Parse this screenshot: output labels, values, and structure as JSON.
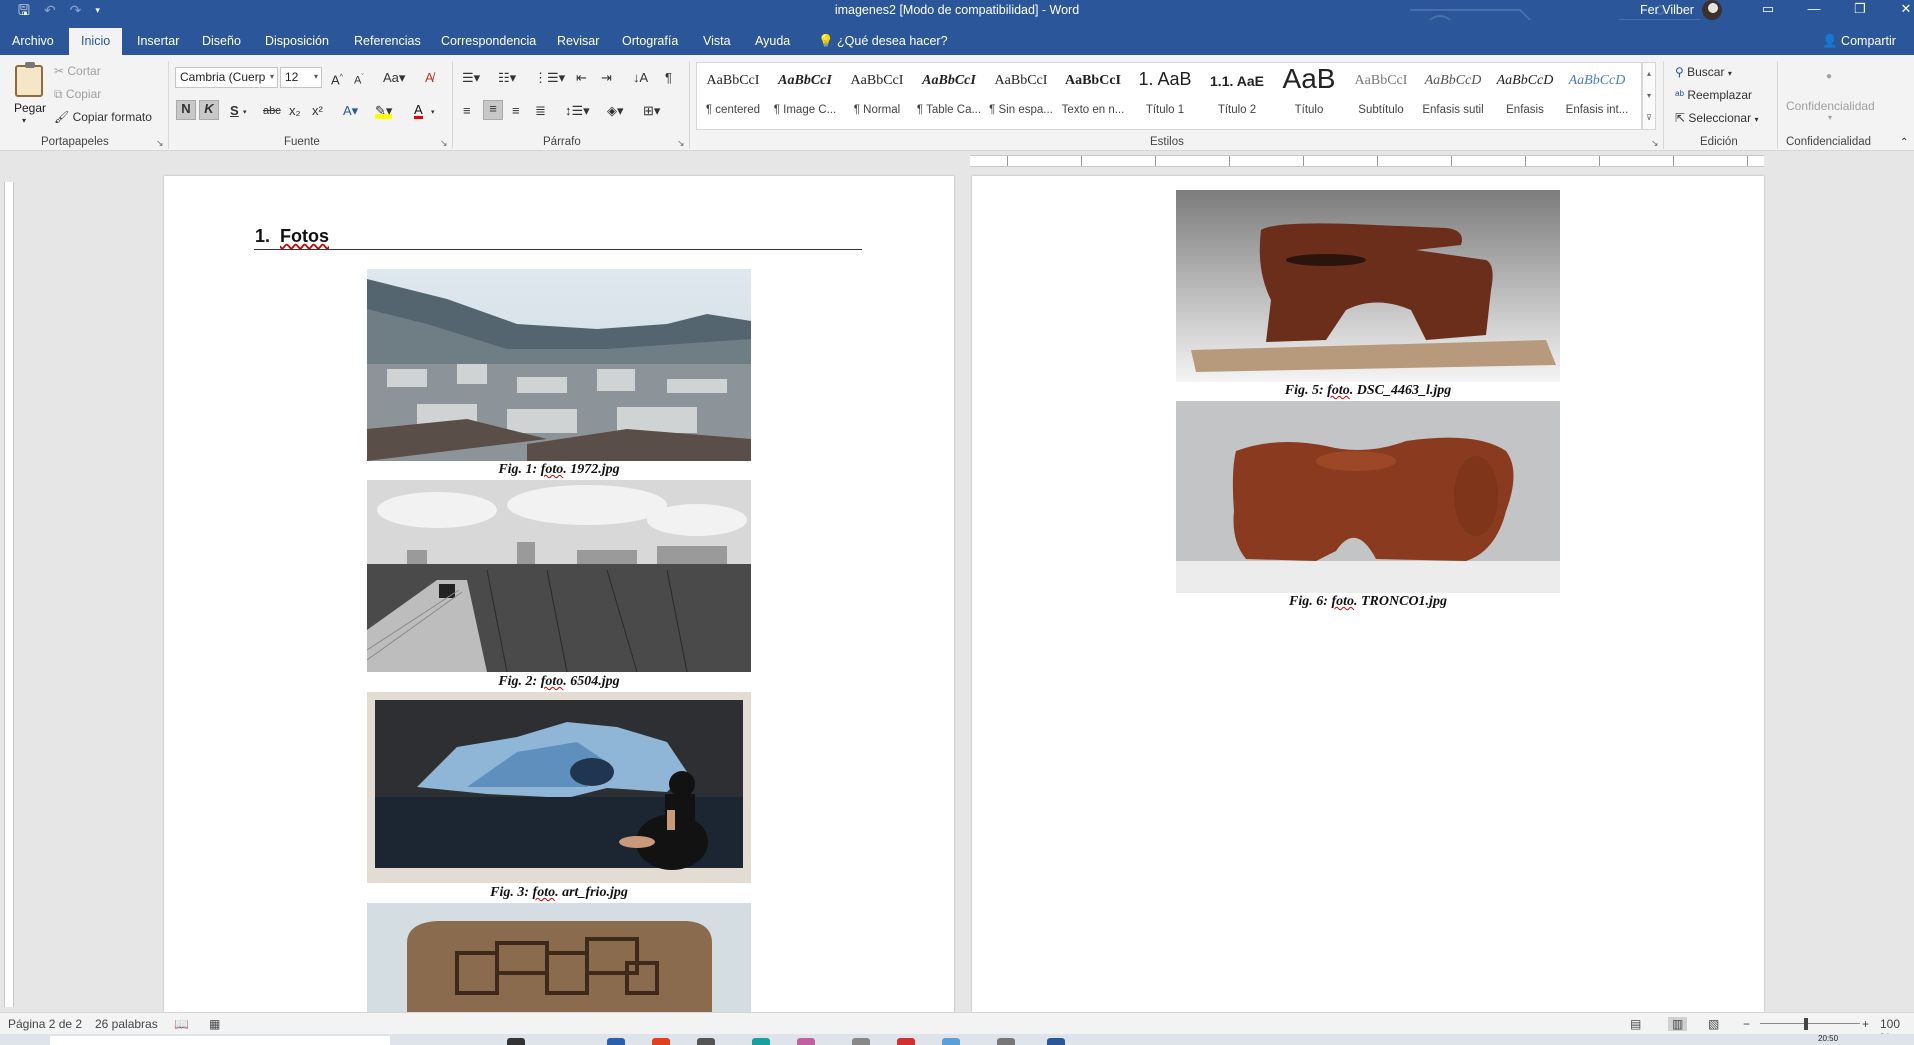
{
  "window": {
    "title": "imagenes2 [Modo de compatibilidad]  -  Word",
    "user_name": "Fer Vilber",
    "qat": {
      "save_icon": "save-icon",
      "undo_icon": "undo-icon",
      "redo_icon": "redo-icon",
      "customize_icon": "chevron-down-icon"
    }
  },
  "tabs": [
    "Archivo",
    "Inicio",
    "Insertar",
    "Diseño",
    "Disposición",
    "Referencias",
    "Correspondencia",
    "Revisar",
    "Ortografía",
    "Vista",
    "Ayuda"
  ],
  "tell_me": "¿Qué desea hacer?",
  "share": "Compartir",
  "clipboard": {
    "paste": "Pegar",
    "cut": "Cortar",
    "copy": "Copiar",
    "format_painter": "Copiar formato",
    "label": "Portapapeles"
  },
  "font": {
    "name": "Cambria (Cuerp",
    "size": "12",
    "label": "Fuente",
    "bold": "N",
    "italic": "K",
    "underline": "S",
    "strike": "abc"
  },
  "paragraph": {
    "label": "Párrafo"
  },
  "styles": {
    "label": "Estilos",
    "items": [
      {
        "sample": "AaBbCcI",
        "name": "¶ centered"
      },
      {
        "sample": "AaBbCcI",
        "name": "¶ Image C..."
      },
      {
        "sample": "AaBbCcI",
        "name": "¶ Normal"
      },
      {
        "sample": "AaBbCcI",
        "name": "¶ Table Ca..."
      },
      {
        "sample": "AaBbCcI",
        "name": "¶ Sin espa..."
      },
      {
        "sample": "AaBbCcI",
        "name": "Texto en n..."
      },
      {
        "sample": "1.  AaB",
        "name": "Título 1"
      },
      {
        "sample": "1.1.  AaE",
        "name": "Título 2"
      },
      {
        "sample": "AaB",
        "name": "Título"
      },
      {
        "sample": "AaBbCcI",
        "name": "Subtítulo"
      },
      {
        "sample": "AaBbCcD",
        "name": "Énfasis sutil"
      },
      {
        "sample": "AaBbCcD",
        "name": "Énfasis"
      },
      {
        "sample": "AaBbCcD",
        "name": "Énfasis int..."
      }
    ]
  },
  "editing": {
    "find": "Buscar",
    "replace": "Reemplazar",
    "select": "Seleccionar",
    "label": "Edición"
  },
  "sensitivity": {
    "button": "Confidencialidad",
    "label": "Confidencialidad"
  },
  "document": {
    "heading_number": "1.",
    "heading_text": "Fotos",
    "figures": [
      {
        "prefix": "Fig. 1:",
        "word": "foto",
        "file": ". 1972.jpg"
      },
      {
        "prefix": "Fig. 2:",
        "word": "foto",
        "file": ". 6504.jpg"
      },
      {
        "prefix": "Fig. 3:",
        "word": "foto",
        "file": ". art_frio.jpg"
      },
      {
        "prefix": "Fig. 5:",
        "word": "foto",
        "file": ". DSC_4463_l.jpg"
      },
      {
        "prefix": "Fig. 6:",
        "word": "foto",
        "file": ". TRONCO1.jpg"
      }
    ]
  },
  "status": {
    "page": "Página 2 de 2",
    "words": "26 palabras",
    "zoom": "100 %"
  },
  "taskbar_clock": "20:50"
}
